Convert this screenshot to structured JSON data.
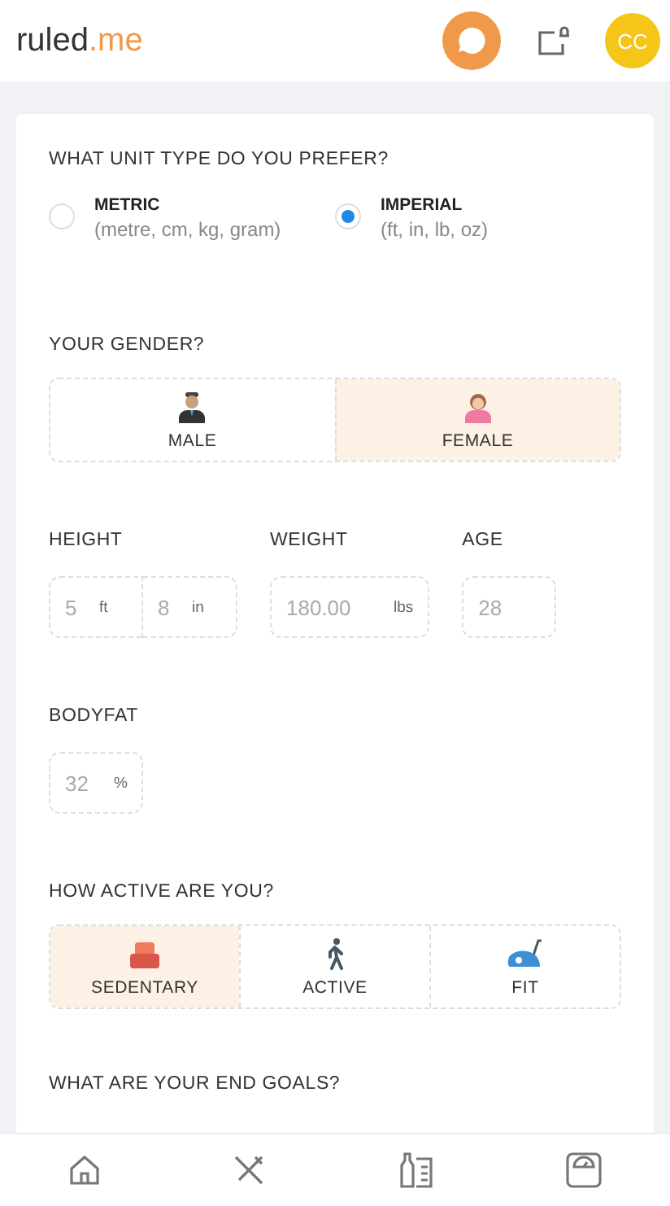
{
  "header": {
    "logo": {
      "name": "ruled",
      "suffix": ".me"
    },
    "avatar": "CC"
  },
  "unit": {
    "question": "WHAT UNIT TYPE DO YOU PREFER?",
    "options": [
      {
        "label": "METRIC",
        "hint": "(metre, cm, kg, gram)",
        "selected": false
      },
      {
        "label": "IMPERIAL",
        "hint": "(ft, in, lb, oz)",
        "selected": true
      }
    ]
  },
  "gender": {
    "question": "YOUR GENDER?",
    "options": [
      {
        "label": "MALE",
        "kind": "male",
        "selected": false
      },
      {
        "label": "FEMALE",
        "kind": "female",
        "selected": true
      }
    ]
  },
  "measures": [
    {
      "label": "HEIGHT",
      "parts": [
        {
          "value": "5",
          "unit": "ft"
        },
        {
          "value": "8",
          "unit": "in"
        }
      ]
    },
    {
      "label": "WEIGHT",
      "parts": [
        {
          "value": "180.00",
          "unit": "lbs"
        }
      ]
    },
    {
      "label": "AGE",
      "parts": [
        {
          "value": "28"
        }
      ]
    }
  ],
  "bodyfat": {
    "label": "BODYFAT",
    "parts": [
      {
        "value": "32",
        "unit": "%"
      }
    ]
  },
  "activity": {
    "question": "HOW ACTIVE ARE YOU?",
    "options": [
      {
        "label": "SEDENTARY",
        "kind": "sedentary",
        "selected": true
      },
      {
        "label": "ACTIVE",
        "kind": "active",
        "selected": false
      },
      {
        "label": "FIT",
        "kind": "fit",
        "selected": false
      }
    ]
  },
  "goals": {
    "question": "WHAT ARE YOUR END GOALS?"
  },
  "nav": [
    {
      "kind": "home"
    },
    {
      "kind": "meals"
    },
    {
      "kind": "shopping"
    },
    {
      "kind": "scale"
    }
  ]
}
